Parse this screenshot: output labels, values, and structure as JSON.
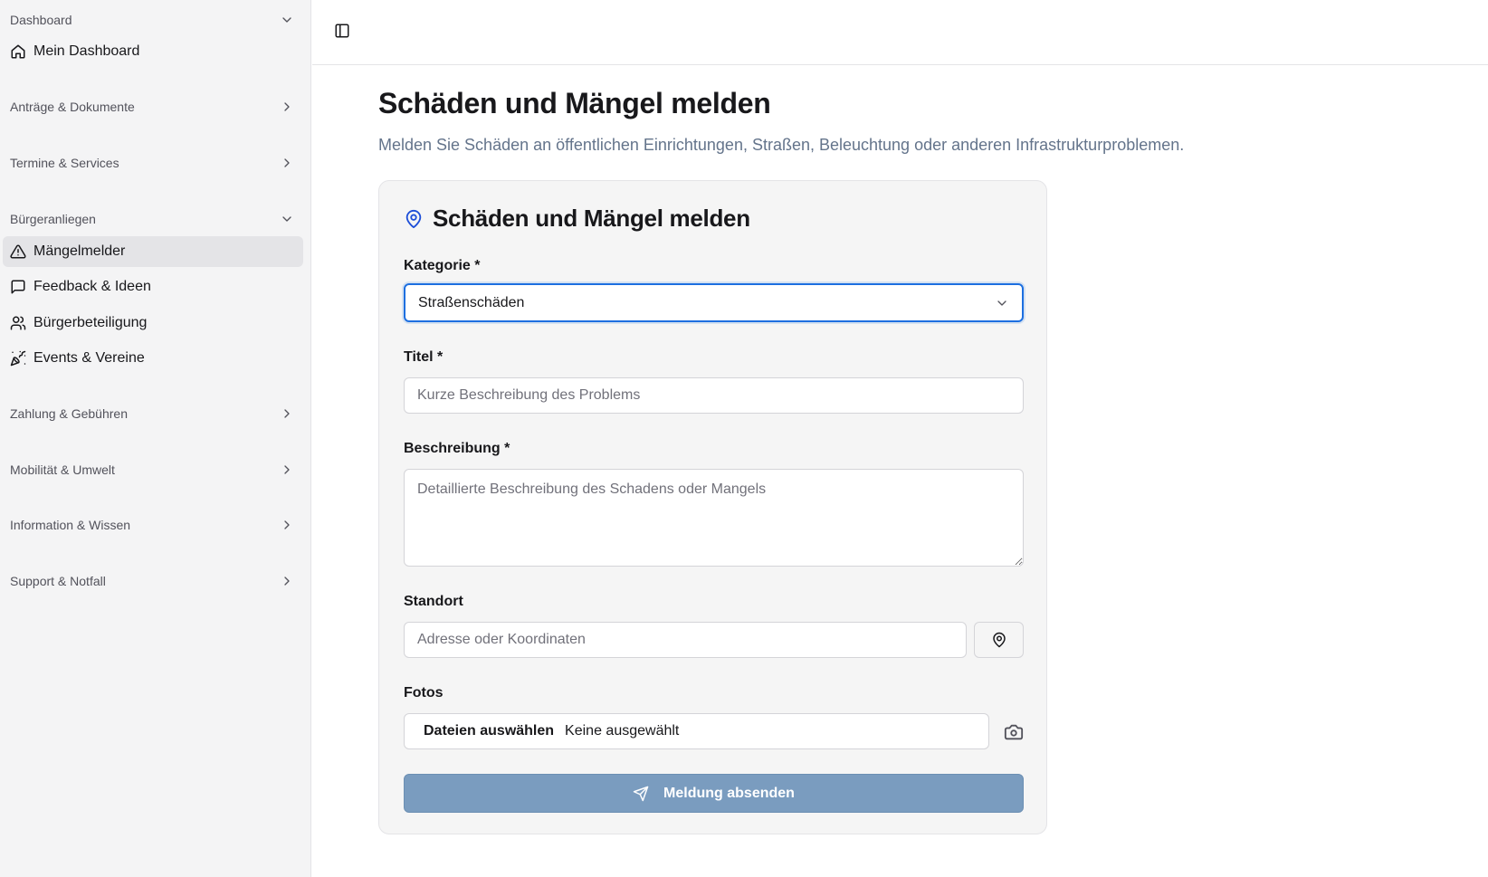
{
  "sidebar": {
    "groups": [
      {
        "label": "Dashboard",
        "expanded": true,
        "items": [
          {
            "label": "Mein Dashboard",
            "icon": "home-icon"
          }
        ]
      },
      {
        "label": "Anträge & Dokumente",
        "expanded": false
      },
      {
        "label": "Termine & Services",
        "expanded": false
      },
      {
        "label": "Bürgeranliegen",
        "expanded": true,
        "items": [
          {
            "label": "Mängelmelder",
            "icon": "alert-triangle-icon",
            "active": true
          },
          {
            "label": "Feedback & Ideen",
            "icon": "message-square-icon"
          },
          {
            "label": "Bürgerbeteiligung",
            "icon": "users-icon"
          },
          {
            "label": "Events & Vereine",
            "icon": "party-popper-icon"
          }
        ]
      },
      {
        "label": "Zahlung & Gebühren",
        "expanded": false
      },
      {
        "label": "Mobilität & Umwelt",
        "expanded": false
      },
      {
        "label": "Information & Wissen",
        "expanded": false
      },
      {
        "label": "Support & Notfall",
        "expanded": false
      }
    ]
  },
  "header": {
    "toggle_icon": "sidebar-toggle-icon"
  },
  "main": {
    "title": "Schäden und Mängel melden",
    "subtitle": "Melden Sie Schäden an öffentlichen Einrichtungen, Straßen, Beleuchtung oder anderen Infrastrukturproblemen."
  },
  "form": {
    "title": "Schäden und Mängel melden",
    "title_icon": "map-pin-icon",
    "category": {
      "label": "Kategorie *",
      "value": "Straßenschäden"
    },
    "titel": {
      "label": "Titel *",
      "placeholder": "Kurze Beschreibung des Problems",
      "value": ""
    },
    "description": {
      "label": "Beschreibung *",
      "placeholder": "Detaillierte Beschreibung des Schadens oder Mangels",
      "value": ""
    },
    "location": {
      "label": "Standort",
      "placeholder": "Adresse oder Koordinaten",
      "value": "",
      "button_icon": "map-pin-icon"
    },
    "photos": {
      "label": "Fotos",
      "button_label": "Dateien auswählen",
      "status": "Keine ausgewählt",
      "camera_icon": "camera-icon"
    },
    "submit": {
      "label": "Meldung absenden",
      "icon": "send-icon"
    }
  },
  "colors": {
    "accent_focus": "#1d6fe0",
    "submit_bg": "#7a9cbf",
    "sidebar_bg": "#f4f4f5",
    "card_bg": "#f5f5f5"
  }
}
